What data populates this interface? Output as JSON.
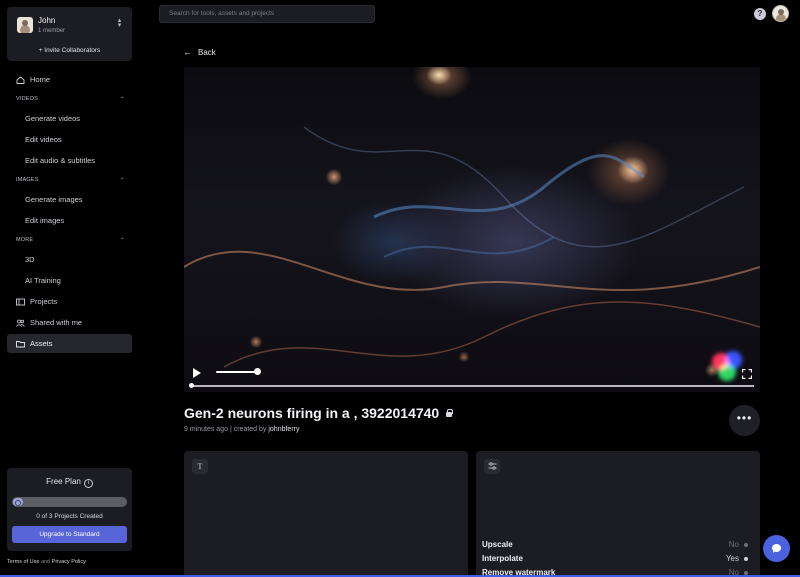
{
  "team": {
    "name": "John",
    "members": "1 member",
    "invite_label": "+ Invite Collaborators"
  },
  "nav": {
    "home": "Home",
    "videos_section": "VIDEOS",
    "videos": [
      "Generate videos",
      "Edit videos",
      "Edit audio & subtitles"
    ],
    "images_section": "IMAGES",
    "images": [
      "Generate images",
      "Edit images"
    ],
    "more_section": "MORE",
    "more": [
      "3D",
      "AI Training"
    ],
    "projects": "Projects",
    "shared": "Shared with me",
    "assets": "Assets"
  },
  "plan": {
    "title": "Free Plan",
    "projects_created": "0 of 3 Projects Created",
    "progress": 0,
    "upgrade_label": "Upgrade to Standard"
  },
  "legal": {
    "terms": "Terms of Use",
    "and": "and",
    "privacy": "Privacy Policy"
  },
  "search": {
    "placeholder": "Search for tools, assets and projects"
  },
  "help": {
    "glyph": "?"
  },
  "back_label": "Back",
  "asset": {
    "title": "Gen-2 neurons firing in a , 3922014740",
    "time": "9 minutes ago",
    "separator": "|",
    "created_by": "created by",
    "author": "johnbferry",
    "more_glyph": "•••"
  },
  "player": {
    "volume": 0.75,
    "progress": 0
  },
  "panels": {
    "text_icon": "T",
    "settings_icon": "sliders-icon",
    "settings": [
      {
        "label": "Upscale",
        "value": "No"
      },
      {
        "label": "Interpolate",
        "value": "Yes"
      },
      {
        "label": "Remove watermark",
        "value": "No"
      }
    ]
  },
  "colors": {
    "accent": "#5865d8",
    "background": "#000000",
    "panel": "#1c1d22"
  }
}
